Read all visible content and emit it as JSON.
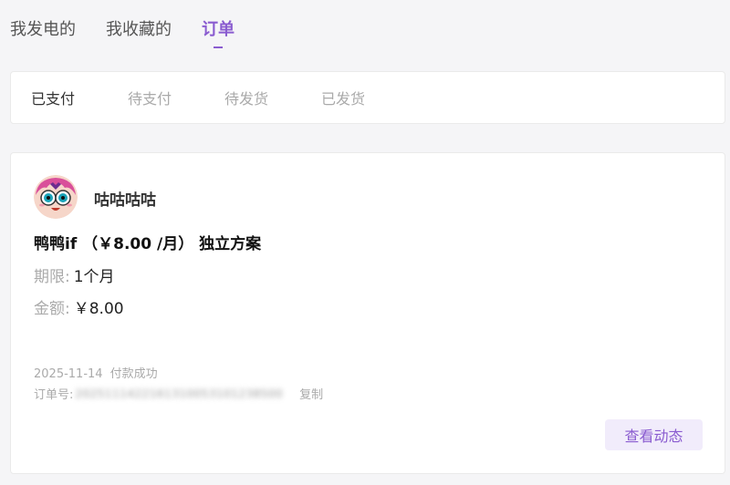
{
  "top_tabs": [
    {
      "label": "我发电的",
      "active": false
    },
    {
      "label": "我收藏的",
      "active": false
    },
    {
      "label": "订单",
      "active": true
    }
  ],
  "sub_tabs": [
    {
      "label": "已支付",
      "active": true
    },
    {
      "label": "待支付",
      "active": false
    },
    {
      "label": "待发货",
      "active": false
    },
    {
      "label": "已发货",
      "active": false
    }
  ],
  "order": {
    "creator_name": "咕咕咕咕",
    "title": "鸭鸭if （￥8.00 /月） 独立方案",
    "term_label": "期限:",
    "term_value": "1个月",
    "amount_label": "金额:",
    "amount_value": "￥8.00",
    "date": "2025-11-14",
    "status": "付款成功",
    "order_no_label": "订单号:",
    "order_no": "2025111422161310053101238500",
    "copy_label": "复制",
    "view_button": "查看动态"
  },
  "colors": {
    "accent": "#8a5cd0",
    "button_bg": "#f1ecfb",
    "page_bg": "#f5f5f7"
  },
  "icons": {
    "avatar": "anime-character-avatar"
  }
}
